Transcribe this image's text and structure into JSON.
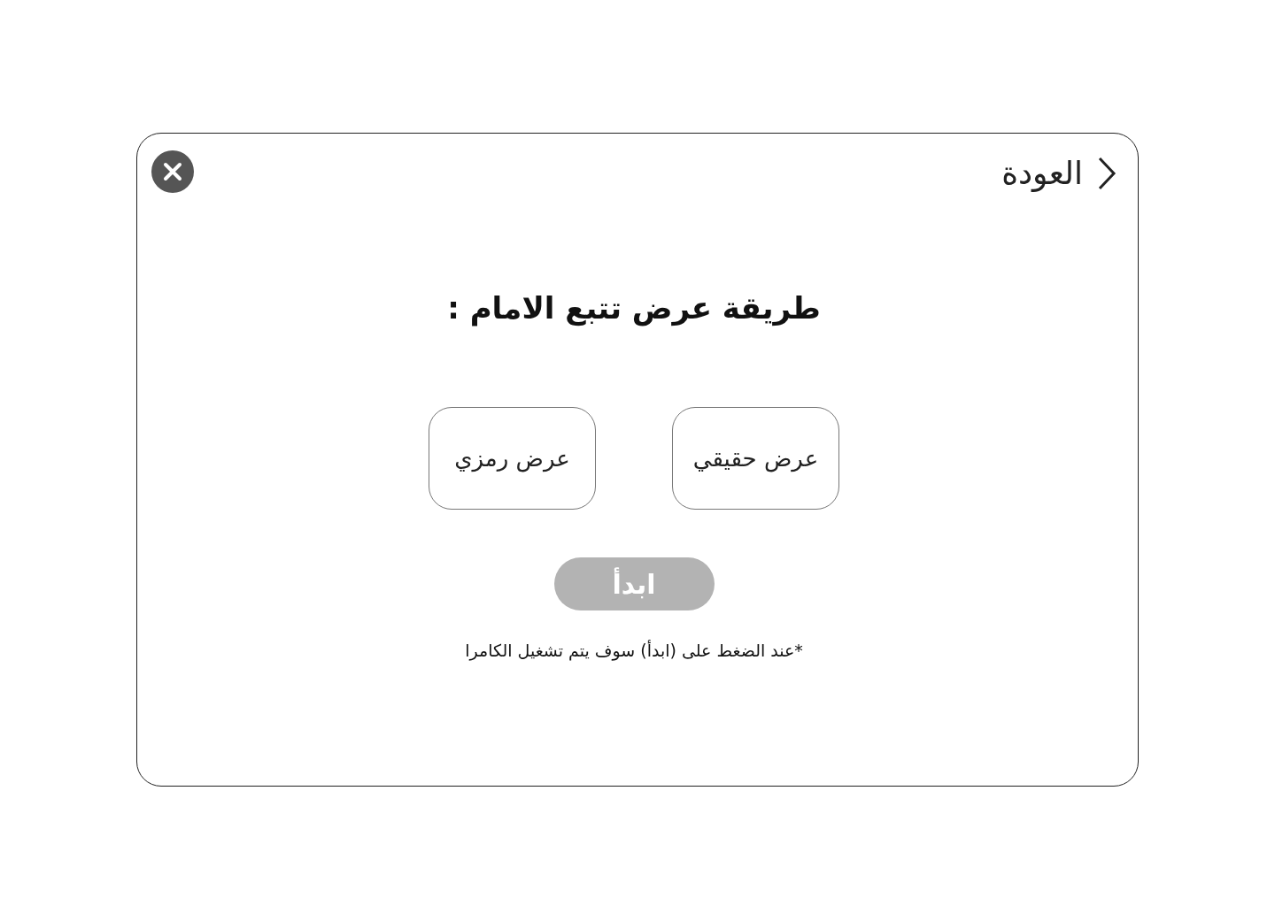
{
  "back": {
    "label": "العودة"
  },
  "title": "طريقة عرض تتبع الامام :",
  "options": [
    {
      "label": "عرض حقيقي",
      "selected": false
    },
    {
      "label": "عرض رمزي",
      "selected": false
    }
  ],
  "start": {
    "label": "ابدأ",
    "disabled": true
  },
  "note": "*عند الضغط على (ابدأ) سوف يتم تشغيل الكامرا"
}
